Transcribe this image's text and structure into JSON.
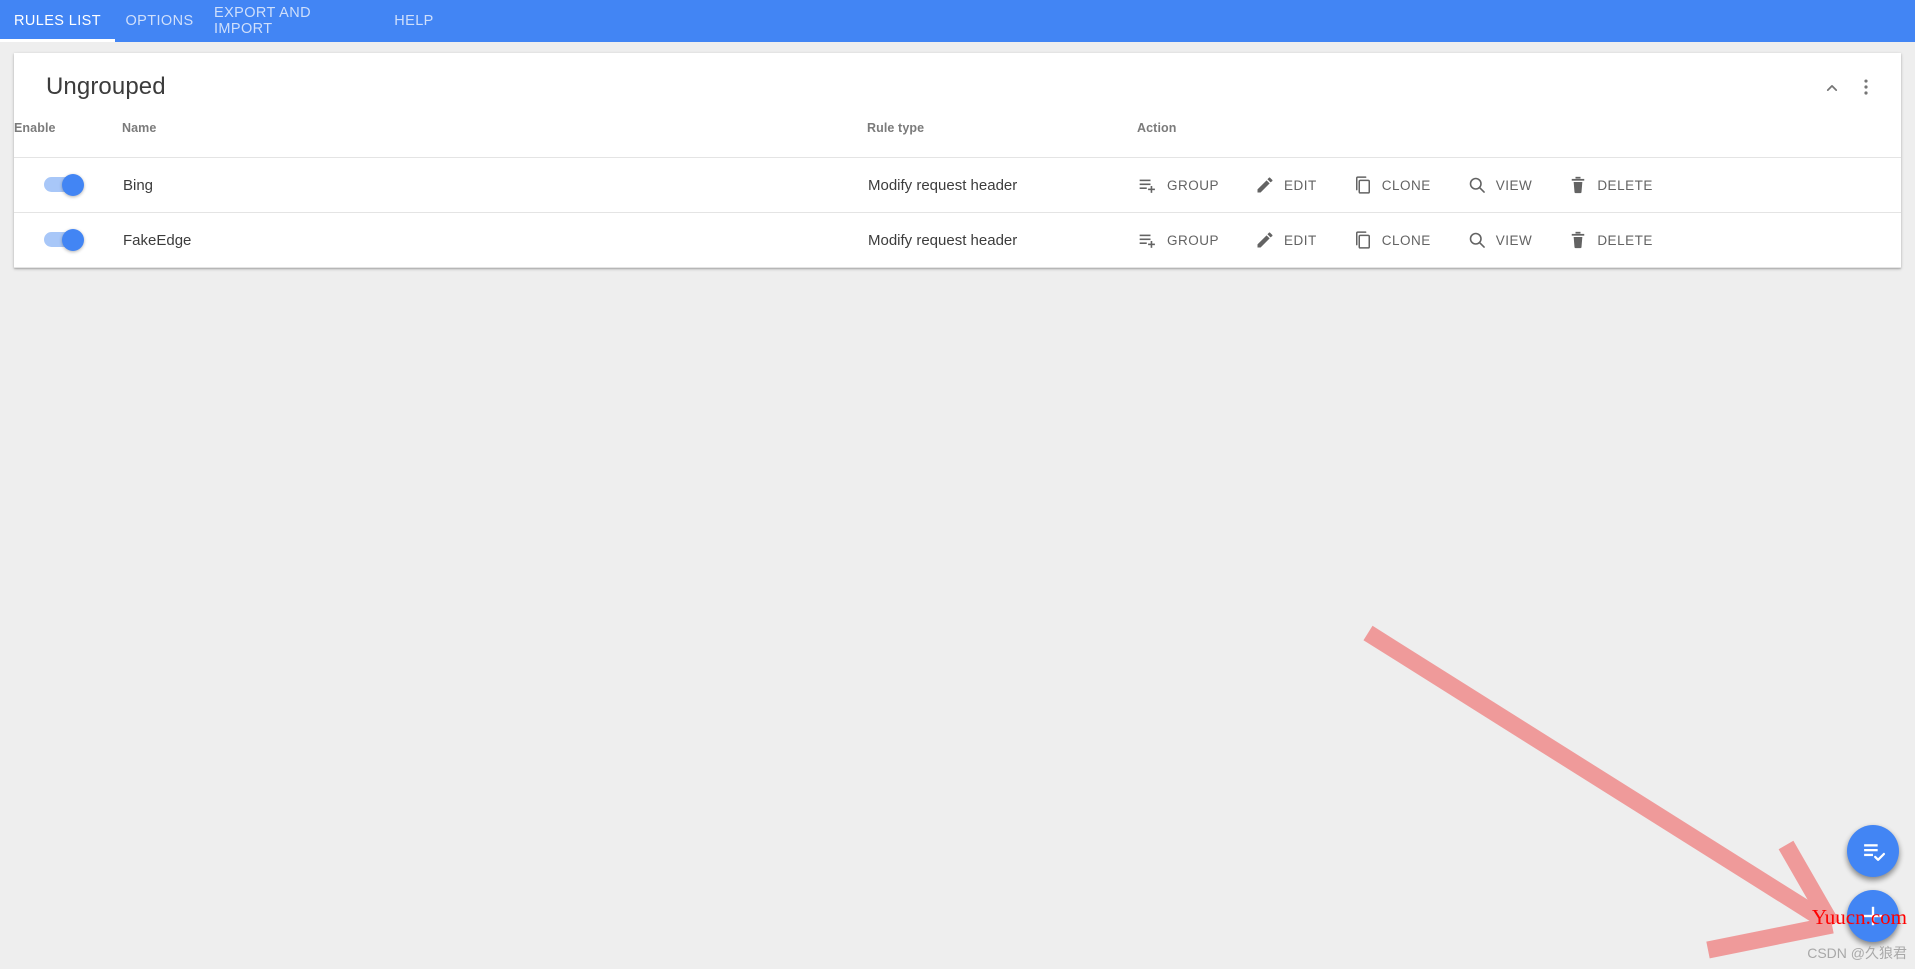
{
  "nav": {
    "tabs": [
      {
        "id": "rules-list",
        "label": "RULES LIST",
        "active": true
      },
      {
        "id": "options",
        "label": "OPTIONS",
        "active": false
      },
      {
        "id": "export-import",
        "label": "EXPORT AND IMPORT",
        "active": false
      },
      {
        "id": "help",
        "label": "HELP",
        "active": false
      }
    ],
    "background_color": "#4285f4",
    "active_text_color": "#ffffff",
    "inactive_text_color": "#cfdffb"
  },
  "card": {
    "title": "Ungrouped",
    "collapse_icon": "chevron-up-icon",
    "more_icon": "more-vertical-icon"
  },
  "table": {
    "columns": [
      "Enable",
      "Name",
      "Rule type",
      "Action"
    ],
    "rows": [
      {
        "enabled": true,
        "name": "Bing",
        "rule_type": "Modify request header",
        "actions": [
          {
            "id": "group",
            "label": "GROUP",
            "icon": "playlist-add-icon"
          },
          {
            "id": "edit",
            "label": "EDIT",
            "icon": "pencil-icon"
          },
          {
            "id": "clone",
            "label": "CLONE",
            "icon": "copy-icon"
          },
          {
            "id": "view",
            "label": "VIEW",
            "icon": "search-icon"
          },
          {
            "id": "delete",
            "label": "DELETE",
            "icon": "trash-icon"
          }
        ]
      },
      {
        "enabled": true,
        "name": "FakeEdge",
        "rule_type": "Modify request header",
        "actions": [
          {
            "id": "group",
            "label": "GROUP",
            "icon": "playlist-add-icon"
          },
          {
            "id": "edit",
            "label": "EDIT",
            "icon": "pencil-icon"
          },
          {
            "id": "clone",
            "label": "CLONE",
            "icon": "copy-icon"
          },
          {
            "id": "view",
            "label": "VIEW",
            "icon": "search-icon"
          },
          {
            "id": "delete",
            "label": "DELETE",
            "icon": "trash-icon"
          }
        ]
      }
    ]
  },
  "fabs": [
    {
      "id": "select-all",
      "icon": "playlist-check-icon",
      "color": "#4285f4"
    },
    {
      "id": "add-rule",
      "icon": "plus-icon",
      "color": "#4285f4"
    }
  ],
  "watermarks": {
    "site": "Yuucn.com",
    "site_color": "#ff0000",
    "author": "CSDN @久狼君",
    "author_color": "#a8a8a8"
  },
  "annotation": {
    "type": "arrow",
    "color": "#ef9a9a",
    "points_to": "add-rule-fab"
  },
  "theme": {
    "page_background": "#eeeeee",
    "card_background": "#ffffff",
    "accent": "#4285f4",
    "text_primary": "#3c3c3c",
    "text_secondary": "#7b7b7b",
    "action_text": "#636363"
  }
}
